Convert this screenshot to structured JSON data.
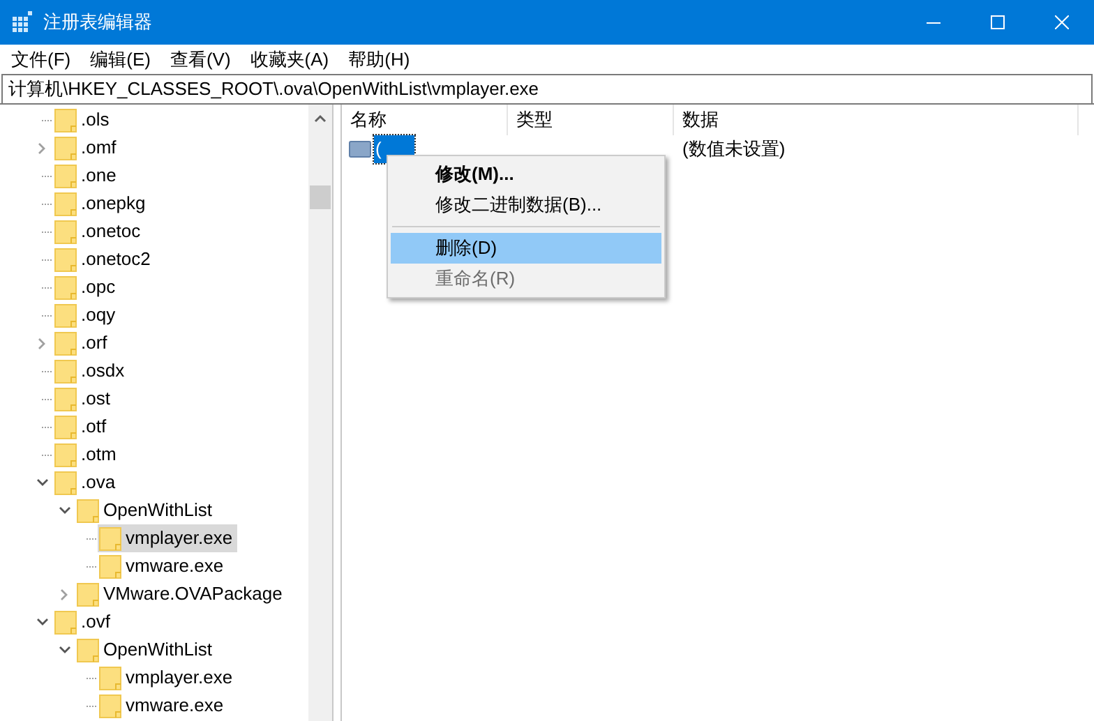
{
  "window": {
    "title": "注册表编辑器"
  },
  "menu_bar": [
    "文件(F)",
    "编辑(E)",
    "查看(V)",
    "收藏夹(A)",
    "帮助(H)"
  ],
  "address_bar": {
    "value": "计算机\\HKEY_CLASSES_ROOT\\.ova\\OpenWithList\\vmplayer.exe"
  },
  "tree": [
    {
      "label": ".ols",
      "kind": "leaf",
      "selected": false
    },
    {
      "label": ".omf",
      "kind": "branch",
      "expanded": false,
      "selected": false
    },
    {
      "label": ".one",
      "kind": "leaf",
      "selected": false
    },
    {
      "label": ".onepkg",
      "kind": "leaf",
      "selected": false
    },
    {
      "label": ".onetoc",
      "kind": "leaf",
      "selected": false
    },
    {
      "label": ".onetoc2",
      "kind": "leaf",
      "selected": false
    },
    {
      "label": ".opc",
      "kind": "leaf",
      "selected": false
    },
    {
      "label": ".oqy",
      "kind": "leaf",
      "selected": false
    },
    {
      "label": ".orf",
      "kind": "branch",
      "expanded": false,
      "selected": false
    },
    {
      "label": ".osdx",
      "kind": "leaf",
      "selected": false
    },
    {
      "label": ".ost",
      "kind": "leaf",
      "selected": false
    },
    {
      "label": ".otf",
      "kind": "leaf",
      "selected": false
    },
    {
      "label": ".otm",
      "kind": "leaf",
      "selected": false
    },
    {
      "label": ".ova",
      "kind": "branch",
      "expanded": true,
      "selected": false,
      "children": [
        {
          "label": "OpenWithList",
          "kind": "branch",
          "expanded": true,
          "selected": false,
          "children": [
            {
              "label": "vmplayer.exe",
              "kind": "leaf",
              "selected": true
            },
            {
              "label": "vmware.exe",
              "kind": "leaf",
              "selected": false
            }
          ]
        },
        {
          "label": "VMware.OVAPackage",
          "kind": "branch",
          "expanded": false,
          "selected": false
        }
      ]
    },
    {
      "label": ".ovf",
      "kind": "branch",
      "expanded": true,
      "selected": false,
      "children": [
        {
          "label": "OpenWithList",
          "kind": "branch",
          "expanded": true,
          "selected": false,
          "children": [
            {
              "label": "vmplayer.exe",
              "kind": "leaf",
              "selected": false
            },
            {
              "label": "vmware.exe",
              "kind": "leaf",
              "selected": false
            }
          ]
        }
      ]
    }
  ],
  "values_table": {
    "columns": [
      "名称",
      "类型",
      "数据"
    ],
    "rows": [
      {
        "name": "(",
        "data": "(数值未设置)",
        "selected": true
      }
    ]
  },
  "context_menu": [
    {
      "kind": "item",
      "label": "修改(M)...",
      "default": true,
      "highlighted": false,
      "disabled": false
    },
    {
      "kind": "item",
      "label": "修改二进制数据(B)...",
      "default": false,
      "highlighted": false,
      "disabled": false
    },
    {
      "kind": "separator"
    },
    {
      "kind": "item",
      "label": "删除(D)",
      "default": false,
      "highlighted": true,
      "disabled": false
    },
    {
      "kind": "item",
      "label": "重命名(R)",
      "default": false,
      "highlighted": false,
      "disabled": true
    }
  ]
}
